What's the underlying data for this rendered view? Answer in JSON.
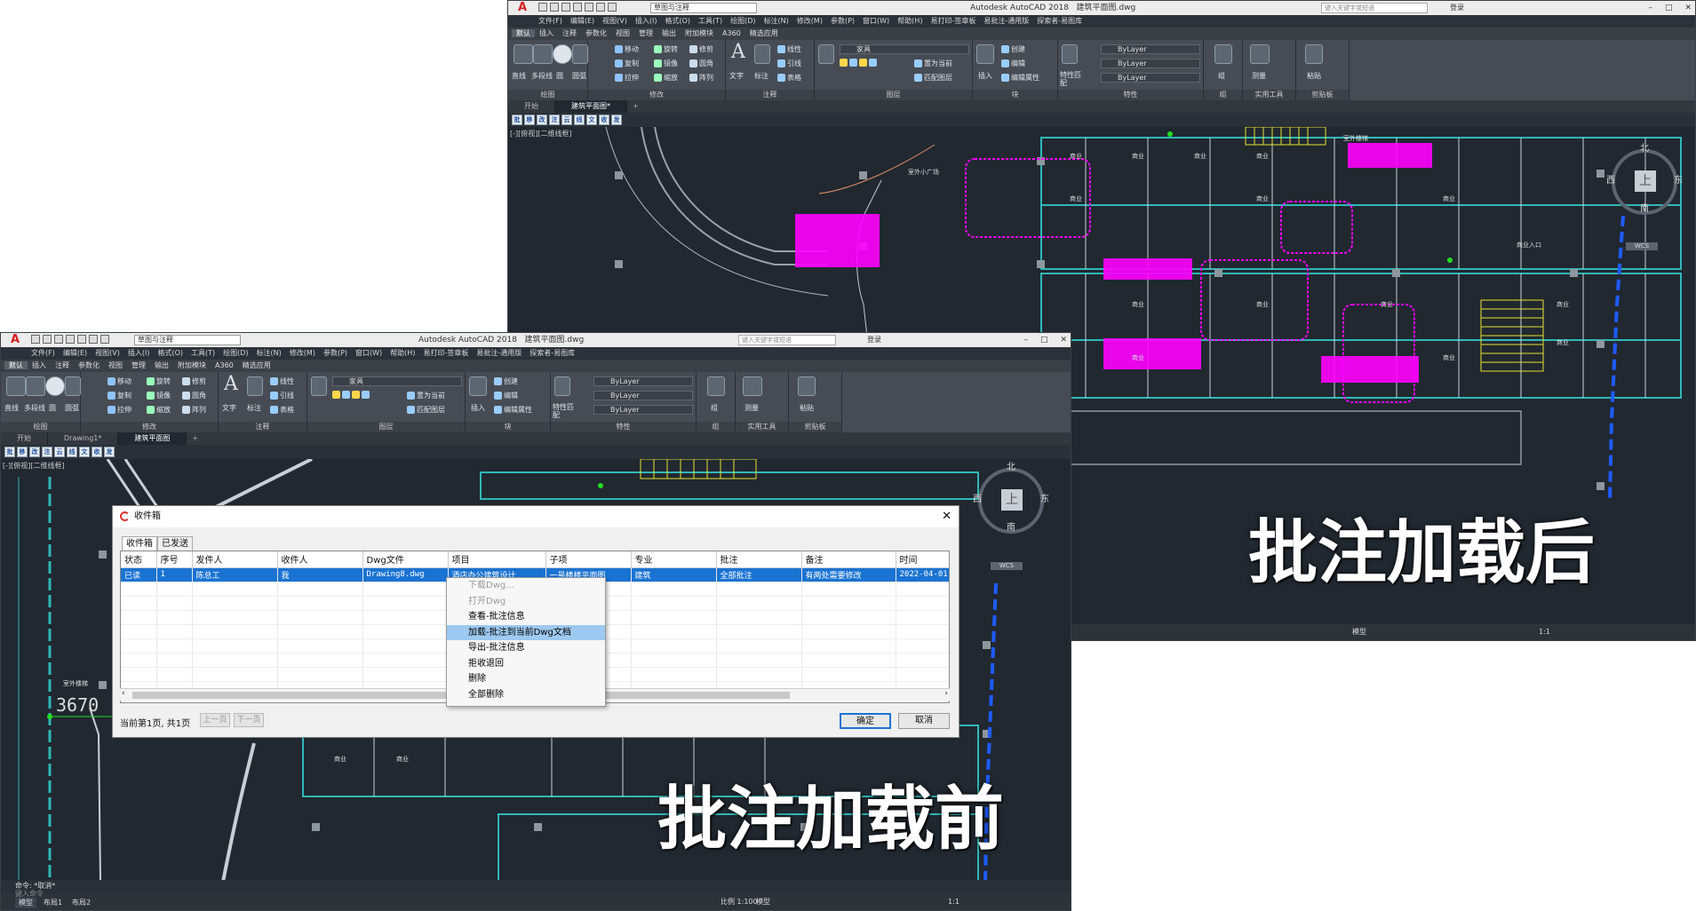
{
  "after_window": {
    "app_title": "Autodesk AutoCAD 2018",
    "file_title": "建筑平面图.dwg",
    "workspace": "草图与注释",
    "search_placeholder": "键入关键字或短语",
    "login": "登录",
    "menu": [
      "文件(F)",
      "编辑(E)",
      "视图(V)",
      "插入(I)",
      "格式(O)",
      "工具(T)",
      "绘图(D)",
      "标注(N)",
      "修改(M)",
      "参数(P)",
      "窗口(W)",
      "帮助(H)",
      "易打印-签章板",
      "易批注-通用版",
      "探索者-易图库"
    ],
    "ribbon_tabs": [
      "默认",
      "插入",
      "注释",
      "参数化",
      "视图",
      "管理",
      "输出",
      "附加模块",
      "A360",
      "精选应用"
    ],
    "panels": [
      "绘图",
      "修改",
      "注释",
      "图层",
      "块",
      "特性",
      "组",
      "实用工具",
      "剪贴板"
    ],
    "draw_tools": [
      "直线",
      "多段线",
      "圆",
      "圆弧"
    ],
    "modify_tools": [
      "移动",
      "旋转",
      "修剪",
      "复制",
      "镜像",
      "圆角",
      "拉伸",
      "缩放",
      "阵列"
    ],
    "annot_tools": [
      "文字",
      "标注",
      "线性",
      "引线",
      "表格"
    ],
    "layer_name": "家具",
    "layer_tools": [
      "置为当前",
      "匹配图层"
    ],
    "block_tools": [
      "插入",
      "创建",
      "编辑",
      "编辑属性"
    ],
    "prop_labels": [
      "特性匹配"
    ],
    "bylayer": [
      "ByLayer",
      "ByLayer",
      "ByLayer"
    ],
    "util_tools": [
      "测量"
    ],
    "clip_tools": [
      "粘贴"
    ],
    "group_label": "组",
    "doc_tabs": [
      "开始",
      "建筑平面图*"
    ],
    "viewport_label": "[-][俯视][二维线框]",
    "viewcube": {
      "top": "上",
      "north": "北",
      "south": "南",
      "east": "东",
      "west": "西",
      "wcs": "WCS"
    },
    "plan_labels": {
      "shop": "商业",
      "plaza": "室外小广场",
      "stair": "室外楼梯",
      "entrance": "商业入口"
    },
    "status": {
      "model": "模型",
      "scale": "1:1"
    }
  },
  "before_window": {
    "app_title": "Autodesk AutoCAD 2018",
    "file_title": "建筑平面图.dwg",
    "workspace": "草图与注释",
    "search_placeholder": "键入关键字或短语",
    "login": "登录",
    "doc_tabs": [
      "开始",
      "Drawing1*",
      "建筑平面图"
    ],
    "viewport_label": "[-][俯视][二维线框]",
    "dimension": "3670",
    "stair_label": "室外楼梯",
    "command_line_1": "命令: *取消*",
    "command_placeholder": "键入命令",
    "layout_tabs": [
      "模型",
      "布局1",
      "布局2"
    ],
    "status": {
      "scale_label": "比例 1:100",
      "model": "模型",
      "scale": "1:1"
    }
  },
  "dialog": {
    "title": "收件箱",
    "tabs": [
      "收件箱",
      "已发送"
    ],
    "columns": [
      "状态",
      "序号",
      "发件人",
      "收件人",
      "Dwg文件",
      "项目",
      "子项",
      "专业",
      "批注",
      "备注",
      "时间"
    ],
    "rows": [
      [
        "已读",
        "1",
        "陈总工",
        "我",
        "Drawing8.dwg",
        "酒店办公建筑设计",
        "一号楼楼平面图",
        "建筑",
        "全部批注",
        "有两处需要修改",
        "2022-04-01"
      ]
    ],
    "page_info": "当前第1页, 共1页",
    "prev_page": "上一页",
    "next_page": "下一页",
    "ok": "确定",
    "cancel": "取消"
  },
  "context_menu": {
    "items": [
      {
        "label": "下载Dwg...",
        "disabled": true
      },
      {
        "label": "打开Dwg",
        "disabled": true
      },
      {
        "label": "查看-批注信息",
        "disabled": false
      },
      {
        "label": "加载-批注到当前Dwg文档",
        "disabled": false,
        "highlighted": true
      },
      {
        "label": "导出-批注信息",
        "disabled": false
      },
      {
        "label": "拒收退回",
        "disabled": false
      },
      {
        "label": "删除",
        "disabled": false
      },
      {
        "label": "全部删除",
        "disabled": false
      }
    ]
  },
  "captions": {
    "after": "批注加载后",
    "before": "批注加载前"
  },
  "colors": {
    "canvas": "#212830",
    "wall": "#2fb8b8",
    "markup": "#ff00ff",
    "accent_blue": "#1e5bff",
    "selection": "#1a73d2"
  }
}
